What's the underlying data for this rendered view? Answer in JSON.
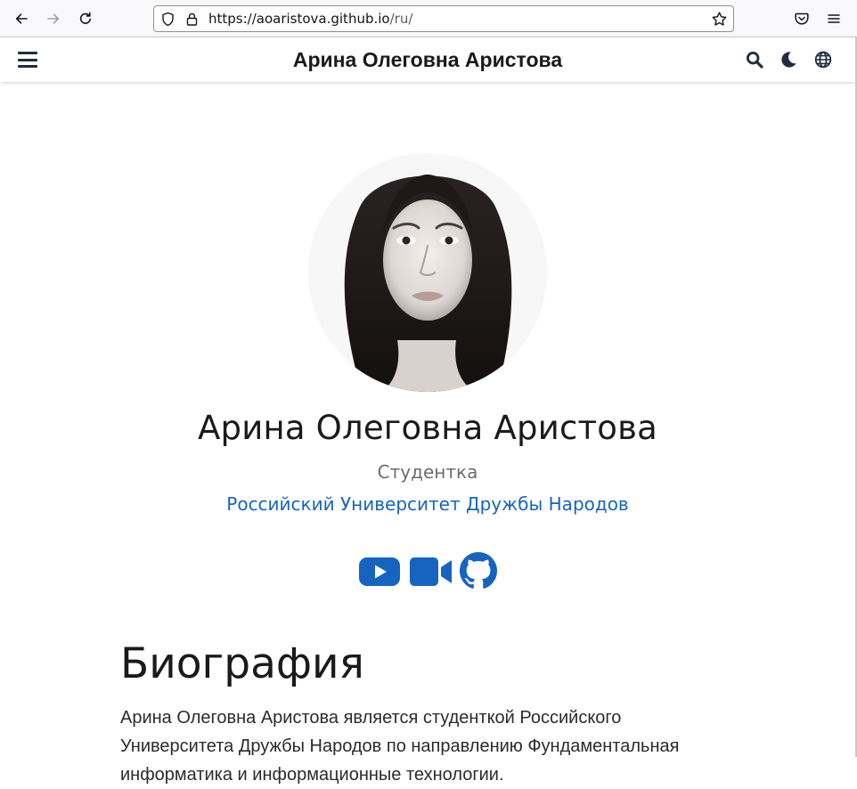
{
  "browser": {
    "url_host": "https://aoaristova.github.io",
    "url_path": "/ru/"
  },
  "header": {
    "title": "Арина Олеговна Аристова",
    "icons": [
      "hamburger-icon",
      "search-icon",
      "moon-icon",
      "globe-icon"
    ]
  },
  "profile": {
    "name": "Арина Олеговна Аристова",
    "role": "Студентка",
    "organization": "Российский Университет Дружбы Народов",
    "social_icons": [
      "youtube-icon",
      "video-camera-icon",
      "github-icon"
    ]
  },
  "biography": {
    "heading": "Биография",
    "text": "Арина Олеговна Аристова является студенткой Российского Университета Дружбы Народов по направлению Фундаментальная информатика и информационные технологии."
  },
  "colors": {
    "link": "#1565c0",
    "text": "#1a1a1a",
    "header_icon": "#1f2d3d"
  }
}
